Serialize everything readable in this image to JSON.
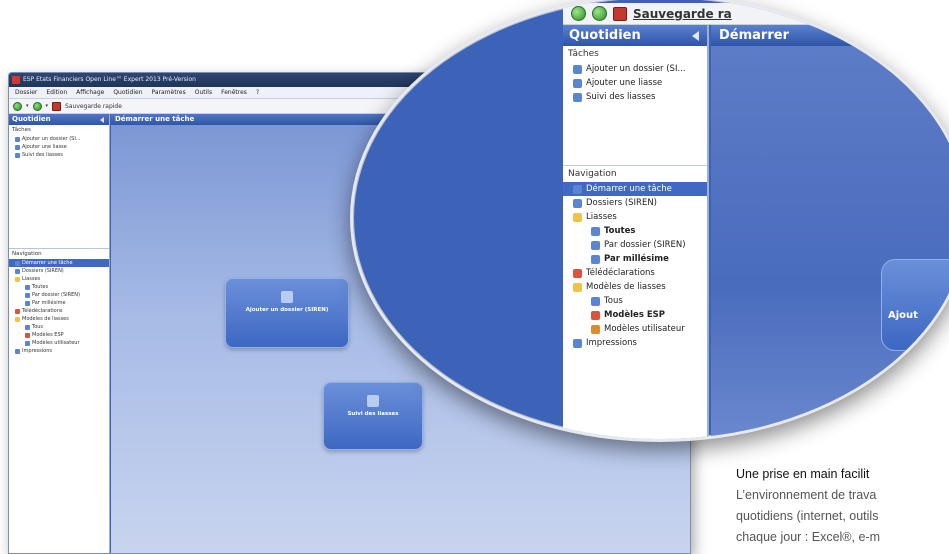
{
  "small_window": {
    "title": "ESP Etats Financiers Open Line™ Expert 2013 Pré-Version",
    "menu": [
      "Dossier",
      "Edition",
      "Affichage",
      "Quotidien",
      "Paramètres",
      "Outils",
      "Fenêtres",
      "?"
    ],
    "toolbar_label": "Sauvegarde rapide",
    "sidebar_title": "Quotidien",
    "tasks_label": "Tâches",
    "tasks": [
      "Ajouter un dossier (SI...",
      "Ajouter une liasse",
      "Suivi des liasses"
    ],
    "nav_label": "Navigation",
    "nav_items": [
      {
        "label": "Démarrer une tâche",
        "selected": true,
        "indent": false,
        "icon": "start-icon"
      },
      {
        "label": "Dossiers (SIREN)",
        "indent": false,
        "icon": "dossiers-icon"
      },
      {
        "label": "Liasses",
        "indent": false,
        "icon": "folder-icon"
      },
      {
        "label": "Toutes",
        "indent": true,
        "icon": "list-icon"
      },
      {
        "label": "Par dossier (SIREN)",
        "indent": true,
        "icon": "list-icon"
      },
      {
        "label": "Par millésime",
        "indent": true,
        "icon": "list-icon"
      },
      {
        "label": "Télédéclarations",
        "indent": false,
        "icon": "teledecl-icon"
      },
      {
        "label": "Modèles de liasses",
        "indent": false,
        "icon": "folder-icon"
      },
      {
        "label": "Tous",
        "indent": true,
        "icon": "list-icon"
      },
      {
        "label": "Modèles ESP",
        "indent": true,
        "icon": "esp-icon"
      },
      {
        "label": "Modèles utilisateur",
        "indent": true,
        "icon": "user-model-icon"
      },
      {
        "label": "Impressions",
        "indent": false,
        "icon": "printer-icon"
      }
    ],
    "main_title": "Démarrer une tâche",
    "tiles": {
      "add_dossier": "Ajouter un dossier (SIREN)",
      "suivi": "Suivi des liasses"
    }
  },
  "zoom": {
    "toolbar_label": "Sauvegarde ra",
    "sidebar_title": "Quotidien",
    "tasks_label": "Tâches",
    "tasks": [
      "Ajouter un dossier (SI...",
      "Ajouter une liasse",
      "Suivi des liasses"
    ],
    "nav_label": "Navigation",
    "nav_items": [
      {
        "label": "Démarrer une tâche",
        "selected": true,
        "indent": false,
        "bold": false,
        "icon": "start-icon"
      },
      {
        "label": "Dossiers (SIREN)",
        "indent": false,
        "bold": false,
        "icon": "dossiers-icon"
      },
      {
        "label": "Liasses",
        "indent": false,
        "bold": false,
        "icon": "folder-icon"
      },
      {
        "label": "Toutes",
        "indent": true,
        "bold": true,
        "icon": "list-icon"
      },
      {
        "label": "Par dossier (SIREN)",
        "indent": true,
        "bold": false,
        "icon": "list-icon"
      },
      {
        "label": "Par millésime",
        "indent": true,
        "bold": true,
        "icon": "list-icon"
      },
      {
        "label": "Télédéclarations",
        "indent": false,
        "bold": false,
        "icon": "teledecl-icon"
      },
      {
        "label": "Modèles de liasses",
        "indent": false,
        "bold": false,
        "icon": "folder-icon"
      },
      {
        "label": "Tous",
        "indent": true,
        "bold": false,
        "icon": "list-icon"
      },
      {
        "label": "Modèles ESP",
        "indent": true,
        "bold": true,
        "icon": "esp-icon"
      },
      {
        "label": "Modèles utilisateur",
        "indent": true,
        "bold": false,
        "icon": "user-model-icon"
      },
      {
        "label": "Impressions",
        "indent": false,
        "bold": false,
        "icon": "printer-icon"
      }
    ],
    "main_title": "Démarrer",
    "tile_label": "Ajout"
  },
  "caption": {
    "title": "Une prise en main facilit",
    "lines": [
      "L’environnement de trava",
      "quotidiens (internet, outils",
      "chaque jour : Excel®, e-m"
    ]
  },
  "colors": {
    "accent": "#3f69c2",
    "workspace": "#3d63b8"
  }
}
